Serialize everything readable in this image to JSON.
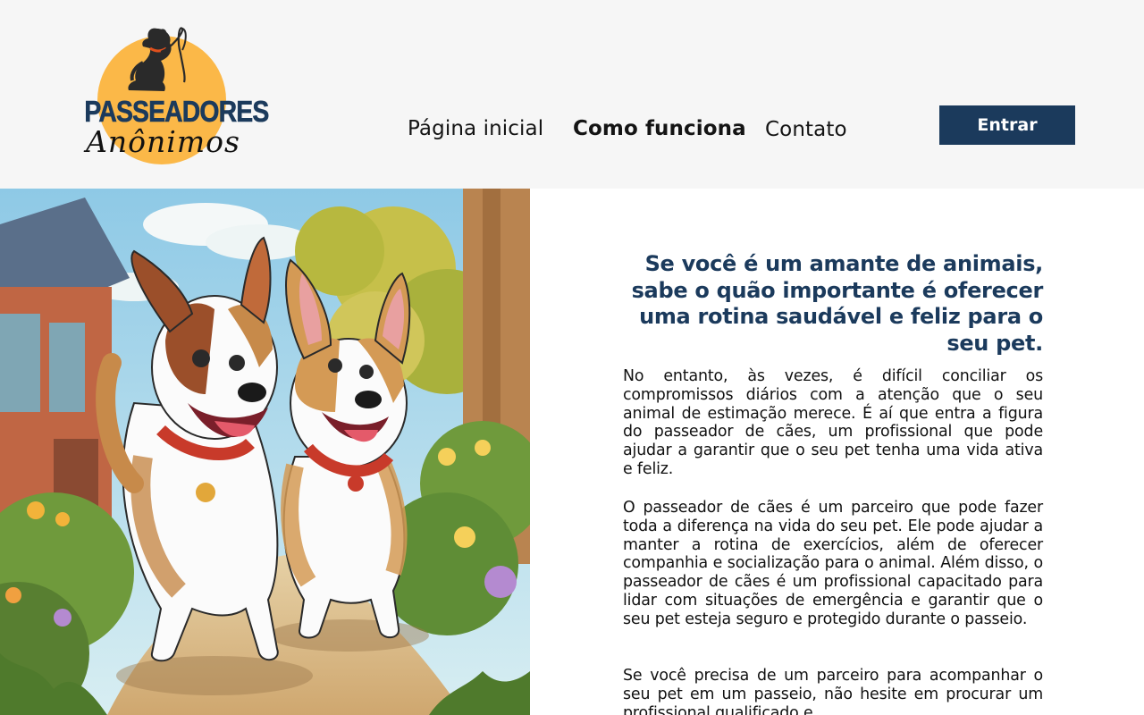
{
  "brand": {
    "line1": "PASSEADORES",
    "line2": "Anônimos",
    "circle_color": "#fbb848",
    "text_color": "#1b3a5c"
  },
  "nav": {
    "home": "Página inicial",
    "how_it_works": "Como funciona",
    "contact": "Contato"
  },
  "login_button": "Entrar",
  "content": {
    "headline": "Se você é um amante de animais, sabe o quão importante é oferecer uma rotina saudável e feliz para o seu pet.",
    "paragraphs": [
      "No entanto, às vezes, é difícil conciliar os compromissos diários com a atenção que o seu animal de estimação merece. É aí que entra a figura do passeador de cães, um profissional que pode ajudar a garantir que o seu pet tenha uma vida ativa e feliz.",
      "O passeador de cães é um parceiro que pode fazer toda a diferença na vida do seu pet. Ele pode ajudar a manter a rotina de exercícios, além de oferecer companhia e socialização para o animal. Além disso, o passeador de cães é um profissional capacitado para lidar com situações de emergência e garantir que o seu pet esteja seguro e protegido durante o passeio.",
      "Se você precisa de um parceiro para acompanhar o seu pet em um passeio, não hesite em procurar um profissional qualificado e"
    ]
  },
  "colors": {
    "header_bg": "#f6f6f6",
    "accent": "#1b3a5c"
  }
}
